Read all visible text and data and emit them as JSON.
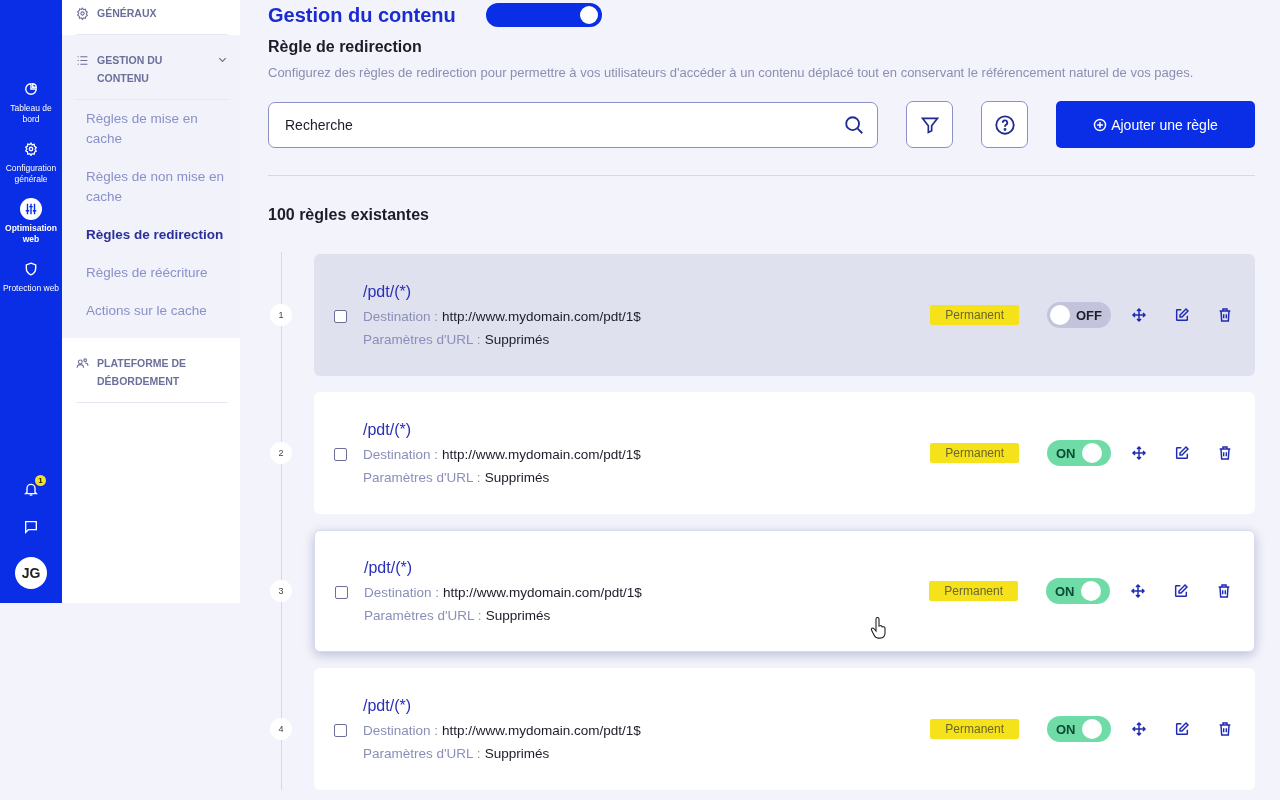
{
  "rail": {
    "items": [
      {
        "kind": "chart",
        "label": "Tableau de bord",
        "selected": false
      },
      {
        "kind": "gear",
        "label": "Configuration générale",
        "selected": false
      },
      {
        "kind": "sliders",
        "label": "Optimisation web",
        "selected": true
      },
      {
        "kind": "shield",
        "label": "Protection web",
        "selected": false
      }
    ],
    "notification_count": "1",
    "avatar": "JG"
  },
  "sidebar": {
    "sections": [
      {
        "kind": "gear",
        "label": "GÉNÉRAUX",
        "expanded": false
      },
      {
        "kind": "list",
        "label": "GESTION DU CONTENU",
        "expanded": true,
        "items": [
          {
            "label": "Règles de mise en cache",
            "selected": false
          },
          {
            "label": "Règles de non mise en cache",
            "selected": false
          },
          {
            "label": "Règles de redirection",
            "selected": true
          },
          {
            "label": "Règles de réécriture",
            "selected": false
          },
          {
            "label": "Actions sur le cache",
            "selected": false
          }
        ]
      },
      {
        "kind": "users",
        "label": "PLATEFORME DE DÉBORDEMENT",
        "expanded": false
      }
    ]
  },
  "header": {
    "title": "Gestion du contenu",
    "toggle_on": true
  },
  "section": {
    "title": "Règle de redirection",
    "description": "Configurez des règles de redirection pour permettre à vos utilisateurs d'accéder à un contenu déplacé tout en conservant le référencement naturel de vos pages."
  },
  "search": {
    "placeholder": "Recherche"
  },
  "add_button": "Ajouter une règle",
  "count": "100 règles existantes",
  "rules": [
    {
      "number": "1",
      "path": "/pdt/(*)",
      "destination_label": "Destination :",
      "destination": "http://www.mydomain.com/pdt/1$",
      "params_label": "Paramètres d'URL :",
      "params": "Supprimés",
      "tag": "Permanent",
      "on": false,
      "on_label": "OFF",
      "checked": false,
      "highlighted": true,
      "hovered": false
    },
    {
      "number": "2",
      "path": "/pdt/(*)",
      "destination_label": "Destination :",
      "destination": "http://www.mydomain.com/pdt/1$",
      "params_label": "Paramètres d'URL :",
      "params": "Supprimés",
      "tag": "Permanent",
      "on": true,
      "on_label": "ON",
      "checked": false,
      "highlighted": false,
      "hovered": false
    },
    {
      "number": "3",
      "path": "/pdt/(*)",
      "destination_label": "Destination :",
      "destination": "http://www.mydomain.com/pdt/1$",
      "params_label": "Paramètres d'URL :",
      "params": "Supprimés",
      "tag": "Permanent",
      "on": true,
      "on_label": "ON",
      "checked": false,
      "highlighted": false,
      "hovered": true
    },
    {
      "number": "4",
      "path": "/pdt/(*)",
      "destination_label": "Destination :",
      "destination": "http://www.mydomain.com/pdt/1$",
      "params_label": "Paramètres d'URL :",
      "params": "Supprimés",
      "tag": "Permanent",
      "on": true,
      "on_label": "ON",
      "checked": false,
      "highlighted": false,
      "hovered": false
    }
  ]
}
